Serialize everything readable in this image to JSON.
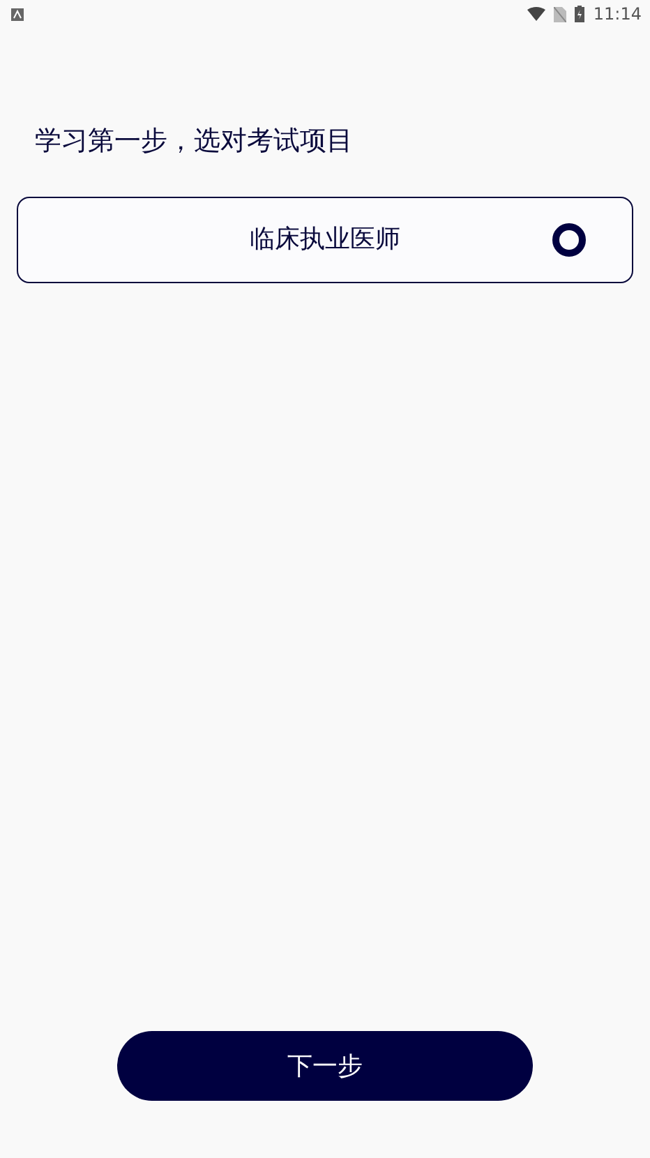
{
  "status_bar": {
    "time": "11:14"
  },
  "heading": "学习第一步，选对考试项目",
  "options": [
    {
      "label": "临床执业医师",
      "selected": false
    }
  ],
  "next_button": "下一步"
}
